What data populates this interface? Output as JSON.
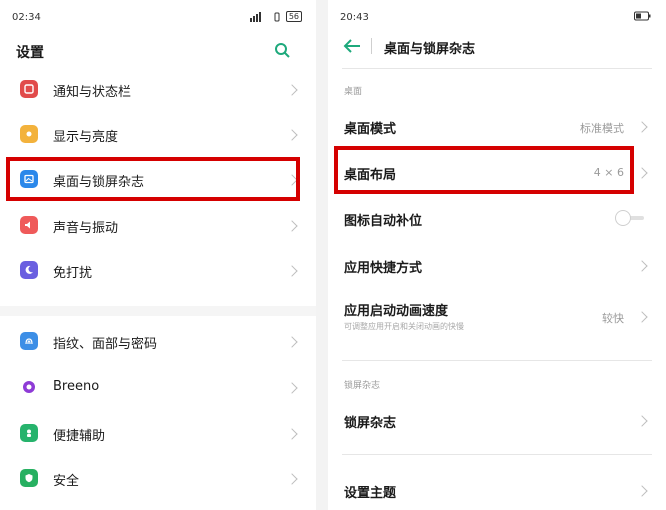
{
  "left": {
    "status": {
      "time": "02:34",
      "battery": "56"
    },
    "title": "设置",
    "items": [
      {
        "label": "通知与状态栏",
        "color": "#e14b4b"
      },
      {
        "label": "显示与亮度",
        "color": "#f3b23c"
      },
      {
        "label": "桌面与锁屏杂志",
        "color": "#2b88ea"
      },
      {
        "label": "声音与振动",
        "color": "#ef5a5a"
      },
      {
        "label": "免打扰",
        "color": "#6a5fe0"
      },
      {
        "label": "指纹、面部与密码",
        "color": "#3c8ee6"
      },
      {
        "label": "Breeno",
        "color": "#8e3bd6"
      },
      {
        "label": "便捷辅助",
        "color": "#26b36c"
      },
      {
        "label": "安全",
        "color": "#27b061"
      }
    ]
  },
  "right": {
    "status": {
      "time": "20:43"
    },
    "title": "桌面与锁屏杂志",
    "section1": "桌面",
    "rows": {
      "desktop_mode": {
        "label": "桌面模式",
        "value": "标准模式"
      },
      "desktop_layout": {
        "label": "桌面布局",
        "value": "4 × 6"
      },
      "auto_fill": {
        "label": "图标自动补位"
      },
      "shortcuts": {
        "label": "应用快捷方式"
      },
      "anim_speed": {
        "label": "应用启动动画速度",
        "sub": "可调整应用开启和关闭动画的快慢",
        "value": "较快"
      }
    },
    "section2": "锁屏杂志",
    "lock_magazine": {
      "label": "锁屏杂志"
    },
    "theme": {
      "label": "设置主题"
    }
  },
  "colors": {
    "accent": "#1ea97c",
    "highlight": "#d50000"
  }
}
